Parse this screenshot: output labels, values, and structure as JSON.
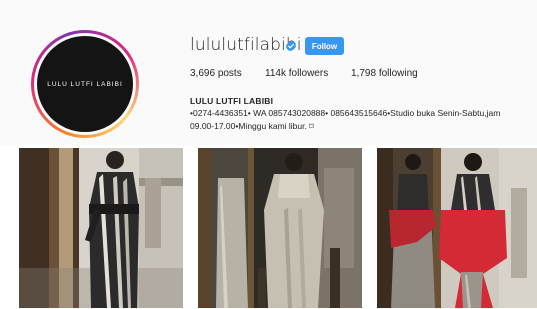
{
  "profile": {
    "username": "lululutfilabibi",
    "avatar_text": "LULU LUTFI LABIBI",
    "follow_label": "Follow",
    "verified_icon": "verified-badge-icon",
    "stats": {
      "posts": "3,696",
      "posts_label": "posts",
      "followers": "114k",
      "followers_label": "followers",
      "following": "1,798",
      "following_label": "following"
    },
    "bio": {
      "name": "LULU LUTFI LABIBI",
      "line1": "•0274-4436351• WA 085743020888• 085643515646•Studio buka Senin-Sabtu,jam",
      "line2": "09.00-17.00•Minggu kami libur. ⌑"
    }
  },
  "colors": {
    "follow_button": "#3897f0",
    "header_bg": "#fafafa",
    "accent_red": "#d42a35"
  },
  "posts": [
    {
      "name": "post-photo-1"
    },
    {
      "name": "post-photo-2"
    },
    {
      "name": "post-photo-3"
    }
  ]
}
